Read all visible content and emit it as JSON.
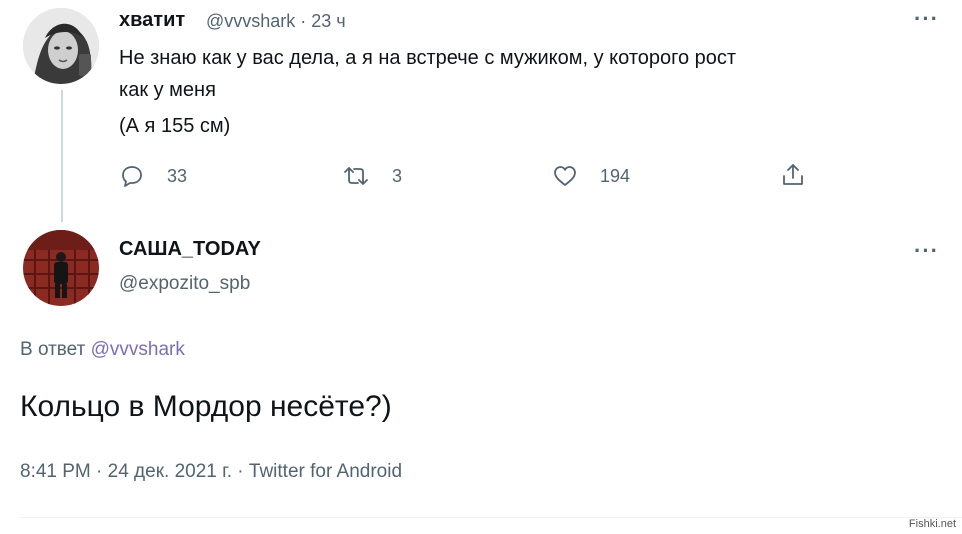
{
  "tweet1": {
    "display_name": "хватит",
    "handle_time": "@vvvshark · 23 ч",
    "more": "···",
    "lines": [
      "Не знаю как у вас дела, а я на встрече с мужиком, у которого рост",
      "как у меня",
      "(А я 155 см)"
    ],
    "actions": {
      "reply_count": "33",
      "retweet_count": "3",
      "like_count": "194"
    },
    "icons": {
      "reply": "reply-icon",
      "retweet": "retweet-icon",
      "like": "heart-icon",
      "share": "share-icon"
    }
  },
  "tweet2": {
    "display_name": "САША_TODAY",
    "handle": "@expozito_spb",
    "more": "···",
    "reply_prefix": "В ответ",
    "reply_handle": "@vvvshark",
    "text": "Кольцо в Мордор несёте?)",
    "timestamp": "8:41 PM · 24 дек. 2021 г. · Twitter for Android"
  },
  "watermark": "Fishki.net",
  "colors": {
    "text": "#0f1419",
    "muted": "#536471",
    "link": "#7a6fb5",
    "thread_line": "#cfd9de"
  }
}
